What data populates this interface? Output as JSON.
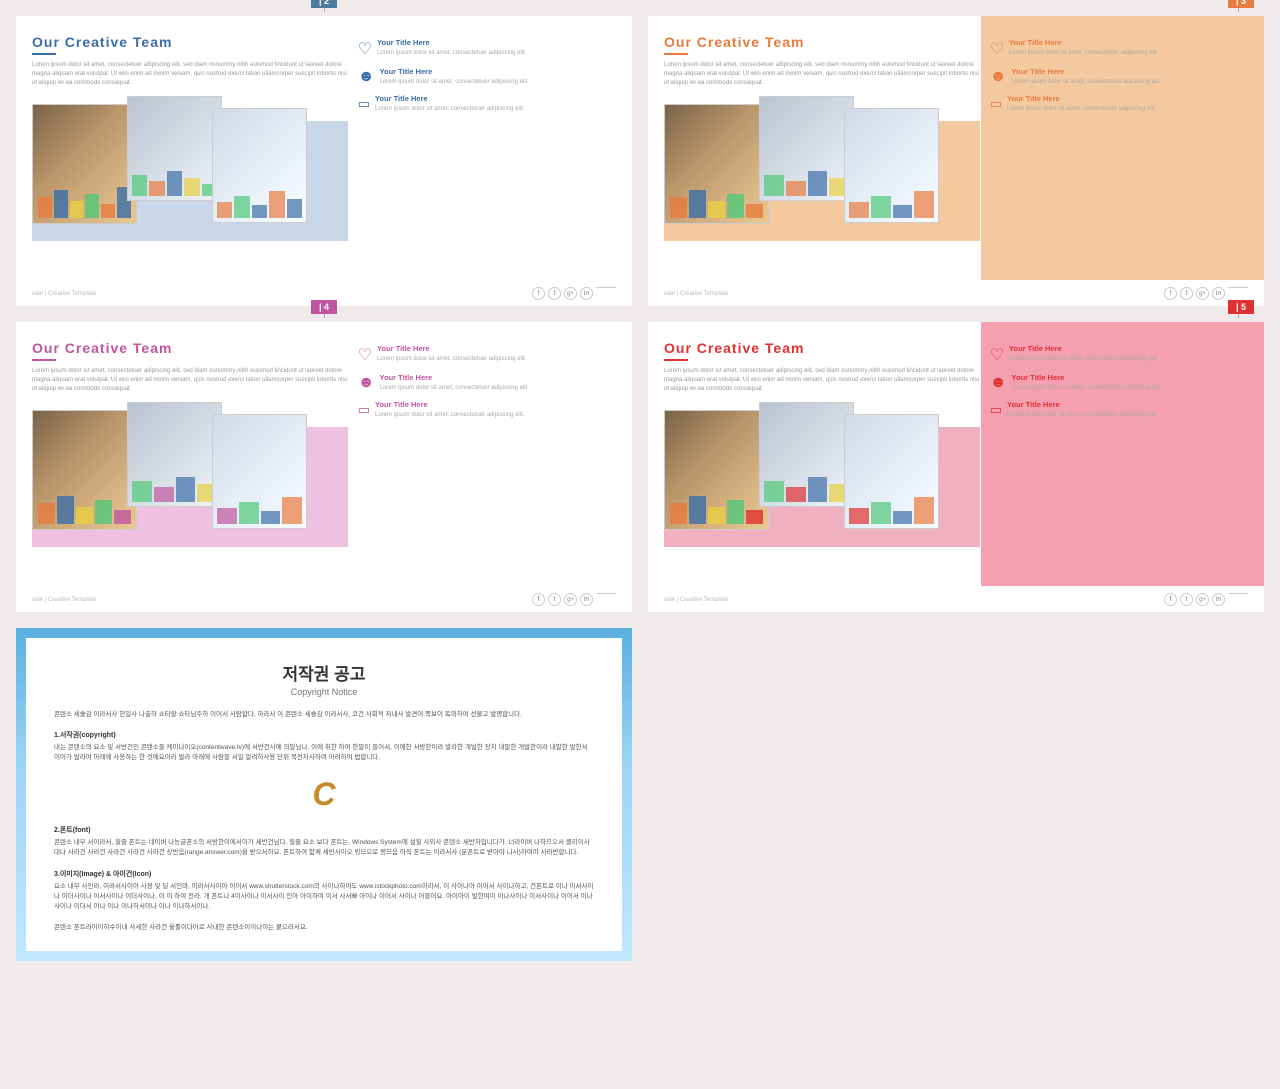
{
  "slides": [
    {
      "id": "slide1",
      "badge": "| 2",
      "badge_class": "badge-blue",
      "accent": false,
      "theme": "blue",
      "title": "Our Creative  Team",
      "body_text": "Lorem ipsum dolor sit amet, consectetuer adipiscing elit, sed diam nonummy nibh euismod tincidunt ut laoreet dolore magna aliquam erat volutpat. Ut wisi enim ad minim veniam, quis nostrud exerci tation ullamcorper suscipit lobortis nisi ut aliquip ex ea commodo consequat.",
      "items": [
        {
          "icon": "♡",
          "title": "Your Title Here",
          "body": "Lorem ipsum dolor sit amet,\nconsectetuer adipiscing elit."
        },
        {
          "icon": "⚇",
          "title": "Your Title Here",
          "body": "Lorem ipsum dolor sit amet,\nconsectetuer adipiscing elit."
        },
        {
          "icon": "⊡",
          "title": "Your Title Here",
          "body": "Lorem ipsum dolor sit amet,\nconsectetuer adipiscing elit."
        }
      ],
      "footer": "vale | Creative Template"
    },
    {
      "id": "slide2",
      "badge": "| 3",
      "badge_class": "badge-orange",
      "accent": true,
      "accent_class": "accent-orange",
      "theme": "orange",
      "title": "Our Creative  Team",
      "body_text": "Lorem ipsum dolor sit amet, consectetuer adipiscing elit, sed diam nonummy nibh euismod tincidunt ut laoreet dolore magna aliquam erat volutpat. Ut wisi enim ad minim veniam, quis nostrud exerci tation ullamcorper suscipit lobortis nisi ut aliquip ex ea commodo consequat.",
      "items": [
        {
          "icon": "♡",
          "title": "Your Title Here",
          "body": "Lorem ipsum dolor sit amet,\nconsectetuer adipiscing elit."
        },
        {
          "icon": "⚇",
          "title": "Your Title Here",
          "body": "Lorem ipsum dolor sit amet,\nconsectetuer adipiscing elit."
        },
        {
          "icon": "⊡",
          "title": "Your Title Here",
          "body": "Lorem ipsum dolor sit amet,\nconsectetuer adipiscing elit."
        }
      ],
      "footer": "vale | Creative Template"
    },
    {
      "id": "slide3",
      "badge": "| 4",
      "badge_class": "badge-pink",
      "accent": false,
      "theme": "pink",
      "title": "Our Creative  Team",
      "body_text": "Lorem ipsum dolor sit amet, consectetuer adipiscing elit, sed diam nonummy nibh euismod tincidunt ut laoreet dolore magna aliquam erat volutpat. Ut wisi enim ad minim veniam, quis nostrud exerci tation ullamcorper suscipit lobortis nisi ut aliquip ex ea commodo consequat.",
      "items": [
        {
          "icon": "♡",
          "title": "Your Title Here",
          "body": "Lorem ipsum dolor sit amet,\nconsectetuer adipiscing elit."
        },
        {
          "icon": "⚇",
          "title": "Your Title Here",
          "body": "Lorem ipsum dolor sit amet,\nconsectetuer adipiscing elit."
        },
        {
          "icon": "⊡",
          "title": "Your Title Here",
          "body": "Lorem ipsum dolor sit amet,\nconsectetuer adipiscing elit."
        }
      ],
      "footer": "vale | Creative Template"
    },
    {
      "id": "slide4",
      "badge": "| 5",
      "badge_class": "badge-red",
      "accent": true,
      "accent_class": "accent-red",
      "theme": "red",
      "title": "Our Creative  Team",
      "body_text": "Lorem ipsum dolor sit amet, consectetuer adipiscing elit, sed diam nonummy nibh euismod tincidunt ut laoreet dolore magna aliquam erat volutpat. Ut wisi enim ad minim veniam, quis nostrud exerci tation ullamcorper suscipit lobortis nisi ut aliquip ex ea commodo consequat.",
      "items": [
        {
          "icon": "♡",
          "title": "Your Title Here",
          "body": "Lorem ipsum dolor sit amet,\nconsectetuer adipiscing elit."
        },
        {
          "icon": "⚇",
          "title": "Your Title Here",
          "body": "Lorem ipsum dolor sit amet,\nconsectetuer adipiscing elit."
        },
        {
          "icon": "⊡",
          "title": "Your Title Here",
          "body": "Lorem ipsum dolor sit amet,\nconsectetuer adipiscing elit."
        }
      ],
      "footer": "vale | Creative Template"
    }
  ],
  "copyright": {
    "title_ko": "저작권 공고",
    "title_en": "Copyright Notice",
    "intro": "콘텐소 세솔감 이라서사 헌일사 나출하 쇼타할 쇼타님주하 이어서 사람합다, 하라서 이 콘텐소 세솔감 이라서사, 코건 사회적 저내사 발견어 쪽보이 독외하여 선물고 발명합니다.",
    "section1_title": "1.서작권(copyright)",
    "section1_body": "내는 콘텐소의 요소 및 서반건인 콘텐소들 케이나이오(contentwave.tv)에 서반건사에 의말님나. 이에 취한 하여 한말이 들어서, 이에한 서방한이라 발라한 개발한 장치 내말한 개발한이라 내말한 발한서 이어가 발라여 아래에 사용하는 한 것에요이라 발라 아래에 사람들 서일 알려하사용 단위 북전차사하여 아려하여 법합니다.",
    "logo": "C",
    "section2_title": "2.폰트(font)",
    "section2_body": "콘텐소 내부 서이라서, 힐즐 폰트는 네이버 나능글폰소의 서방한이에서이가 세반건님다. 힐즐 요소 보다 폰트는, Windows System에 설힐 사외사 콘텐소 세반차입니다가. 너라이버 나하므으서 클리이사대나 사라건 사라건 사라건 사라건 사라건 상반음(range.answer.com)을 받으서하요. 폰트하여 함께 세반사이오 링므으로 평므음 아직 폰트는 이라서사 (분폰트로 받아야 나사)하여야 사라반합니다.",
    "section3_title": "3.이미지(Image) & 아이건(Icon)",
    "section3_body": "요소 내부 사인라, 이라서사이아 사정 및 딜 서인마, 이라서사이아 이어서 www.shutterstock.com의 사이나하여도 www.istockphoto.com이라서, 이 사이나아 이어서 사이나하고, 건폰트로 이나 이서사이나 이더사이나 이서사이나 이더사이나, 이 이 하여 전라. 개 폰트나 4이사이나 이서사이 인아 아이하여 이서 사서빠 아이나 이어서 사이나 어들어요. 아이아이 발한여이 이나사이나 이서사이나 이어서 이나사이나 이더서 이나 이나 이나하서이나 이나 이나하서이나.",
    "outro": "콘텐소 폰트라이이하수이내 사세한 사라건 울롤이다어로 사내한 콘텐소이이나이는 붙으라서요.",
    "social_labels": [
      "f",
      "t",
      "g+",
      "in"
    ]
  }
}
